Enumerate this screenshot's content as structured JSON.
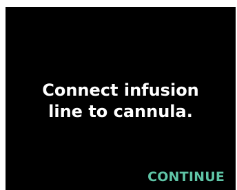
{
  "screen": {
    "instruction": "Connect infusion\nline to cannula.",
    "continue_label": "CONTINUE"
  },
  "colors": {
    "background": "#000000",
    "text": "#ffffff",
    "accent": "#5fc4a6"
  }
}
